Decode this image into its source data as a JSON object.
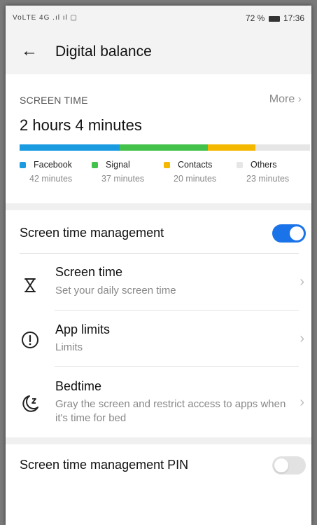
{
  "status_bar": {
    "left_icons": "VoLTE 4G .ıl ıl ▢",
    "battery": "72 %",
    "time": "17:36"
  },
  "header": {
    "back_icon": "arrow-left-icon",
    "title": "Digital balance"
  },
  "screen_time": {
    "section_label": "SCREEN TIME",
    "more_label": "More",
    "total": "2 hours 4 minutes",
    "remainder_color": "#e6e6e6",
    "apps": [
      {
        "name": "Facebook",
        "minutes_label": "42 minutes",
        "minutes": 42,
        "color": "#1a9be0"
      },
      {
        "name": "Signal",
        "minutes_label": "37 minutes",
        "minutes": 37,
        "color": "#43c24b"
      },
      {
        "name": "Contacts",
        "minutes_label": "20 minutes",
        "minutes": 20,
        "color": "#f5b800"
      },
      {
        "name": "Others",
        "minutes_label": "23 minutes",
        "minutes": 23,
        "color": "#e6e6e6"
      }
    ]
  },
  "management": {
    "label": "Screen time management",
    "enabled": true,
    "toggle_color": "#1a73e8",
    "items": [
      {
        "icon": "hourglass-icon",
        "title": "Screen time",
        "subtitle": "Set your daily screen time"
      },
      {
        "icon": "exclamation-circle-icon",
        "title": "App limits",
        "subtitle": "Limits"
      },
      {
        "icon": "moon-zzz-icon",
        "title": "Bedtime",
        "subtitle": "Gray the screen and restrict access to apps when it's time for bed"
      }
    ]
  },
  "pin": {
    "label": "Screen time management PIN",
    "enabled": false
  }
}
